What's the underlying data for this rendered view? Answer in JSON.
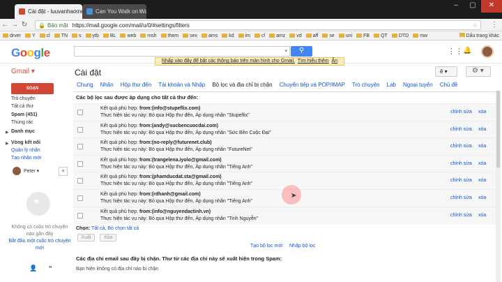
{
  "browser": {
    "tabs": [
      {
        "title": "Cài đặt - luuvanhao.net@",
        "active": true
      },
      {
        "title": "Can You Walk on Water",
        "active": false
      }
    ],
    "url": "https://mail.google.com/mail/u/0/#settings/filters",
    "secure_label": "Bảo mật",
    "bookmarks": [
      "drver",
      "Y",
      "cl",
      "TN",
      "s",
      "ytb",
      "BL",
      "web",
      "msh",
      "them",
      "sex",
      "ams",
      "kd",
      "im",
      "cl",
      "amz",
      "vd",
      "aff",
      "se",
      "uni",
      "FB",
      "QT",
      "DTD",
      "mw"
    ],
    "other_bookmarks": "Dấu trang khác"
  },
  "header": {
    "logo": "Google",
    "search_placeholder": "",
    "search_button": "🔍",
    "user_initials": ""
  },
  "notice": {
    "text": "Nhấp vào đây để bật các thông báo trên màn hình cho Gmail.",
    "learn_more": "Tìm hiểu thêm",
    "hide": "Ẩn"
  },
  "gmail": {
    "label": "Gmail ▾",
    "title": "Cài đặt",
    "lang_button": "ê ▾",
    "gear_button": "⚙ ▾"
  },
  "sidebar": {
    "compose": "SOẠN",
    "items": [
      "Trò chuyện",
      "Tất cả thư",
      "Spam (451)",
      "Thùng rác",
      "Danh mục",
      "Vòng kết nối",
      "Quản lý nhãn",
      "Tạo nhãn mới"
    ],
    "hangout_user": "Peter ▾",
    "hangout_text": "Không có cuộc trò chuyện nào gần đây",
    "hangout_link": "Bắt đầu một cuộc trò chuyện mới"
  },
  "tabs": [
    "Chung",
    "Nhãn",
    "Hộp thư đến",
    "Tài khoản và Nhập",
    "Bộ lọc và địa chỉ bị chặn",
    "Chuyển tiếp và POP/IMAP",
    "Trò chuyện",
    "Lab",
    "Ngoại tuyến",
    "Chủ đề"
  ],
  "filters_heading": "Các bộ lọc sau được áp dụng cho tất cả thư đến:",
  "filters": [
    {
      "from": "from:(info@stupeflix.com)",
      "action": "Thực hiện tác vụ này: Bỏ qua Hộp thư đến, Áp dụng nhãn \"Stupeflix\""
    },
    {
      "from": "from:(andy@sucbencuocdai.com)",
      "action": "Thực hiện tác vụ này: Bỏ qua Hộp thư đến, Áp dụng nhãn \"Sức Bền Cuộc Đại\""
    },
    {
      "from": "from:(no-reply@futurenet.club)",
      "action": "Thực hiện tác vụ này: Bỏ qua Hộp thư đến, Áp dụng nhãn \"FutureNet\""
    },
    {
      "from": "from:(trangelena.iyolo@gmail.com)",
      "action": "Thực hiện tác vụ này: Bỏ qua Hộp thư đến, Áp dụng nhãn \"Tiếng Anh\""
    },
    {
      "from": "from:(phamducdat.sta@gmail.com)",
      "action": "Thực hiện tác vụ này: Bỏ qua Hộp thư đến, Áp dụng nhãn \"Tiếng Anh\""
    },
    {
      "from": "from:(rdhanh@gmail.com)",
      "action": "Thực hiện tác vụ này: Bỏ qua Hộp thư đến, Áp dụng nhãn \"Tiếng Anh\""
    },
    {
      "from": "from:(info@nguyendactinh.vn)",
      "action": "Thực hiện tác vụ này: Bỏ qua Hộp thư đến, Áp dụng nhãn \"Tinh Nguyễn\""
    }
  ],
  "match_prefix": "Kết quả phù hợp: ",
  "edit_label": "chỉnh sửa",
  "delete_label": "xóa",
  "select": {
    "label": "Chọn:",
    "all": "Tất cả",
    "none": "Bỏ chọn tất cả"
  },
  "export_button": "Xuất",
  "delete_button": "Xóa",
  "new_filter": "Tạo bộ lọc mới",
  "import_filter": "Nhập bộ lọc",
  "blocked_heading": "Các địa chỉ email sau đây bị chặn. Thư từ các địa chỉ này sẽ xuất hiện trong Spam:",
  "blocked_text": "Bạn hiện không có địa chỉ nào bị chặn"
}
